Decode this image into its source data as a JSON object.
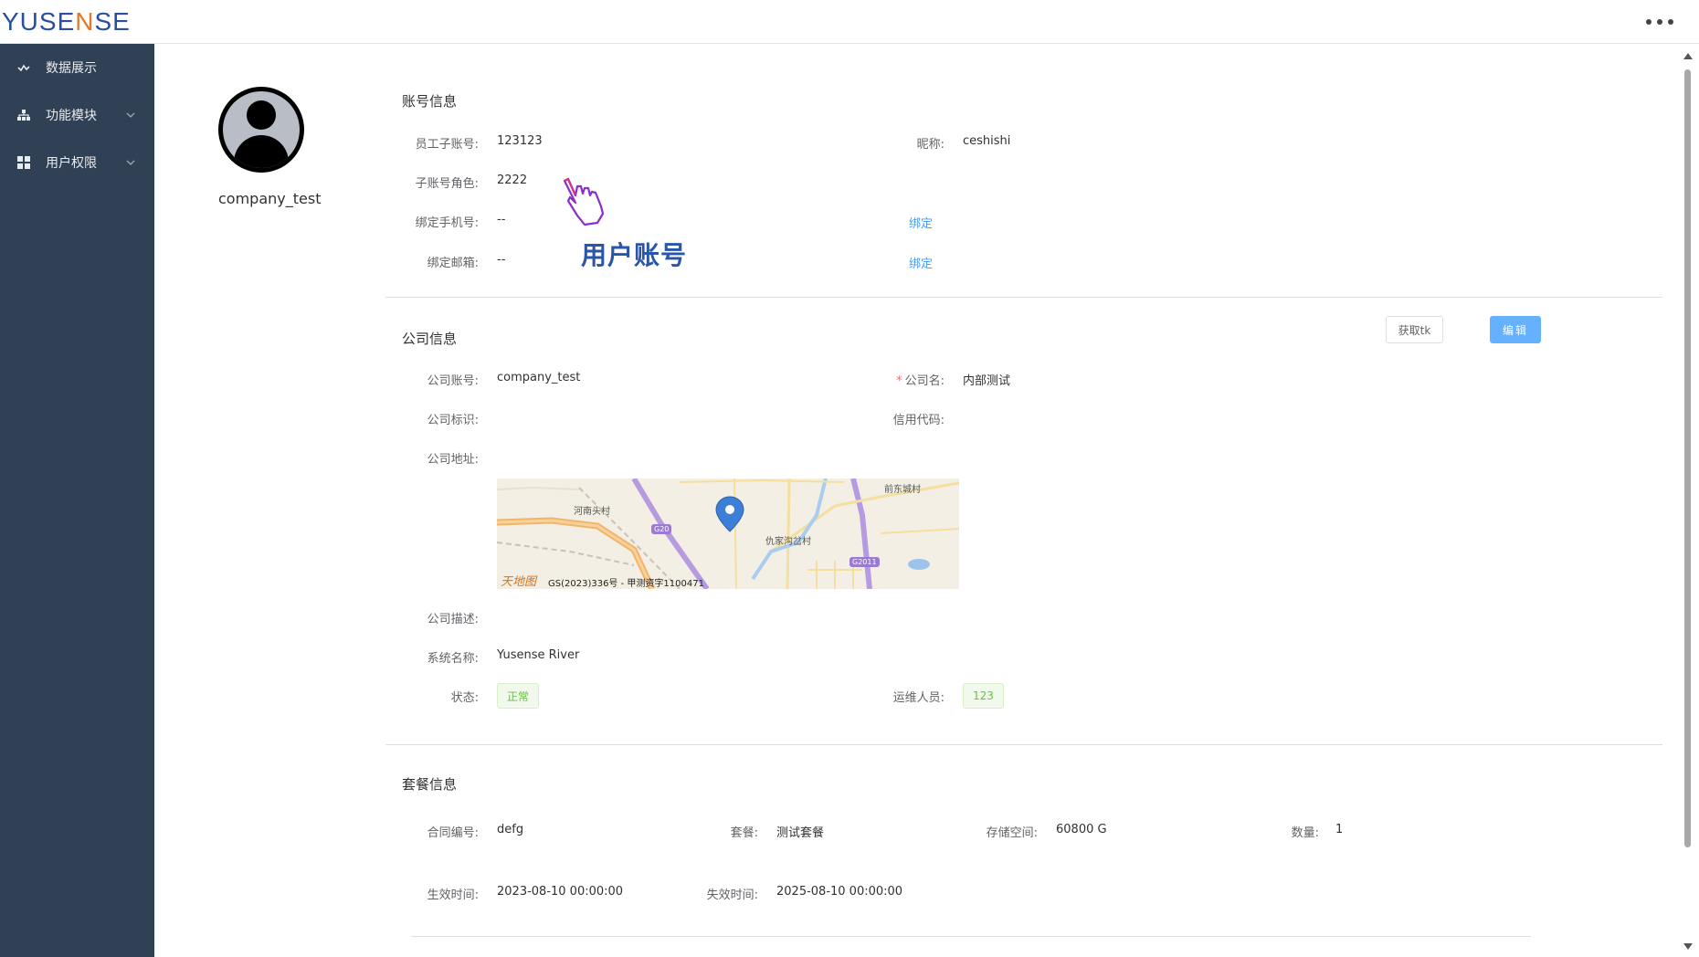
{
  "header": {
    "logo_left": "YUSE",
    "logo_mid": "N",
    "logo_right": "SE"
  },
  "sidebar": {
    "items": [
      {
        "label": "数据展示",
        "icon": "chart-wave-icon"
      },
      {
        "label": "功能模块",
        "icon": "sitemap-icon"
      },
      {
        "label": "用户权限",
        "icon": "grid-icon"
      }
    ]
  },
  "profile": {
    "username": "company_test"
  },
  "account": {
    "title": "账号信息",
    "employee_label": "员工子账号:",
    "employee_value": "123123",
    "nickname_label": "昵称:",
    "nickname_value": "ceshishi",
    "role_label": "子账号角色:",
    "role_value": "2222",
    "phone_label": "绑定手机号:",
    "phone_value": "--",
    "phone_action": "绑定",
    "email_label": "绑定邮箱:",
    "email_value": "--",
    "email_action": "绑定",
    "annotation": "用户账号"
  },
  "company": {
    "title": "公司信息",
    "get_tk_label": "获取tk",
    "edit_label": "编辑",
    "account_label": "公司账号:",
    "account_value": "company_test",
    "name_label": "公司名:",
    "name_value": "内部测试",
    "id_label": "公司标识:",
    "credit_label": "信用代码:",
    "address_label": "公司地址:",
    "map": {
      "labels": [
        "河南头村",
        "前东城村",
        "仇家沟岔村"
      ],
      "roads": [
        "G20",
        "G2011"
      ],
      "brand": "天地图",
      "credit": "GS(2023)336号 - 甲测资字1100471"
    },
    "desc_label": "公司描述:",
    "system_label": "系统名称:",
    "system_value": "Yusense River",
    "status_label": "状态:",
    "status_value": "正常",
    "ops_label": "运维人员:",
    "ops_value": "123"
  },
  "package": {
    "title": "套餐信息",
    "contract_label": "合同编号:",
    "contract_value": "defg",
    "plan_label": "套餐:",
    "plan_value": "测试套餐",
    "storage_label": "存储空间:",
    "storage_value": "60800 G",
    "qty_label": "数量:",
    "qty_value": "1",
    "start_label": "生效时间:",
    "start_value": "2023-08-10 00:00:00",
    "end_label": "失效时间:",
    "end_value": "2025-08-10 00:00:00"
  },
  "colors": {
    "sidebar_bg": "#304156",
    "primary": "#409eff",
    "success": "#67c23a",
    "logo_blue": "#2a4fa0",
    "logo_orange": "#e07a2e"
  }
}
